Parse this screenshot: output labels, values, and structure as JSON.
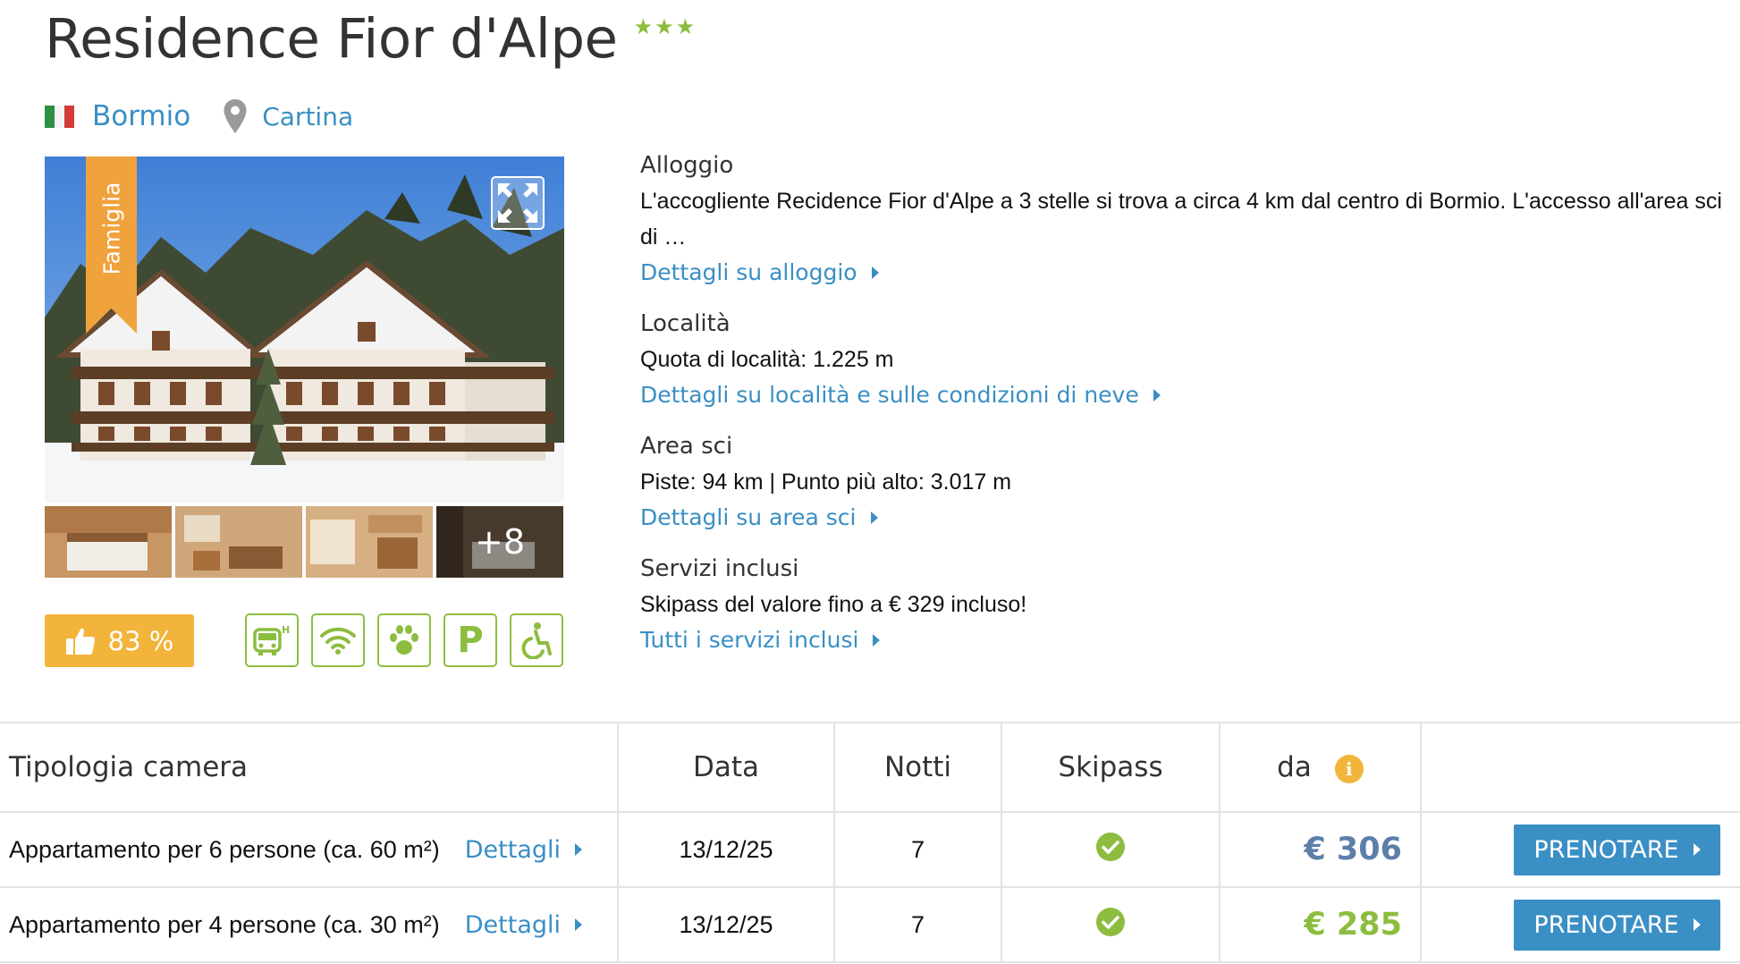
{
  "header": {
    "title": "Residence Fior d'Alpe",
    "stars": "★★★",
    "location": "Bormio",
    "map_label": "Cartina"
  },
  "photo": {
    "badge": "Famiglia",
    "more_count": "+8"
  },
  "rating": {
    "value": "83 %"
  },
  "amenities": [
    "shuttle-icon",
    "wifi-icon",
    "pets-icon",
    "parking-icon",
    "accessible-icon"
  ],
  "amenity_parking_letter": "P",
  "sections": {
    "alloggio": {
      "heading": "Alloggio",
      "text": "L'accogliente Recidence Fior d'Alpe a 3 stelle si trova a circa 4 km dal centro di Bormio. L'accesso all'area sci di …",
      "link": "Dettagli su alloggio"
    },
    "localita": {
      "heading": "Località",
      "text": "Quota di località: 1.225 m",
      "link": "Dettagli su località e sulle condizioni di neve"
    },
    "area": {
      "heading": "Area sci",
      "text": "Piste: 94 km | Punto più alto: 3.017 m",
      "link": "Dettagli su area sci"
    },
    "servizi": {
      "heading": "Servizi inclusi",
      "text": "Skipass del valore fino a € 329 incluso!",
      "link": "Tutti i servizi inclusi"
    }
  },
  "table": {
    "headers": {
      "room": "Tipologia camera",
      "date": "Data",
      "nights": "Notti",
      "skipass": "Skipass",
      "from": "da",
      "info": "i"
    },
    "rows": [
      {
        "room": "Appartamento per 6 persone (ca. 60 m²)",
        "details": "Dettagli",
        "date": "13/12/25",
        "nights": "7",
        "price": "€ 306",
        "price_color": "#5b7fa8",
        "button": "PRENOTARE"
      },
      {
        "room": "Appartamento per 4 persone (ca. 30 m²)",
        "details": "Dettagli",
        "date": "13/12/25",
        "nights": "7",
        "price": "€ 285",
        "price_color": "#8cbd3f",
        "button": "PRENOTARE"
      }
    ]
  },
  "colors": {
    "link": "#3a8fc4",
    "accent_green": "#8cbd3f",
    "accent_orange": "#f2b43a",
    "ribbon": "#f0a23c"
  }
}
